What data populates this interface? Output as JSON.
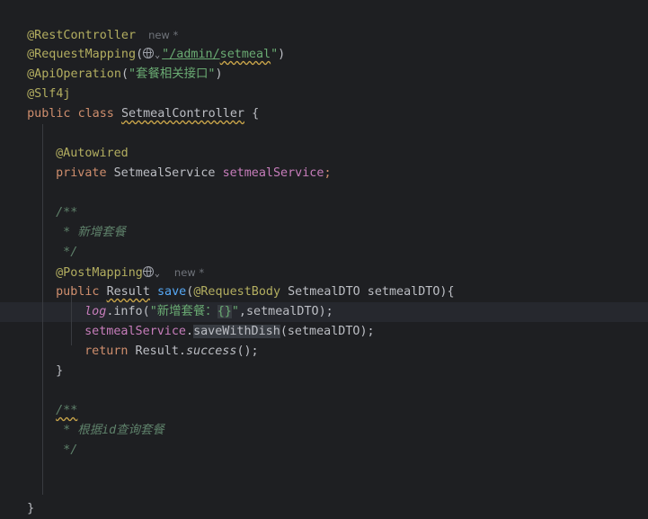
{
  "editor": {
    "inlay_new": "new *",
    "class_annotations": {
      "rest": "@RestController",
      "mapping_name": "@RequestMapping",
      "mapping_open": "(",
      "mapping_path_prefix": "\"/admin/",
      "mapping_path_word": "setmeal",
      "mapping_path_suffix": "\"",
      "mapping_close": ")",
      "api_name": "@ApiOperation",
      "api_open": "(",
      "api_value": "\"套餐相关接口\"",
      "api_close": ")",
      "slf4j": "@Slf4j"
    },
    "class_decl": {
      "public": "public",
      "class": "class",
      "name": "SetmealController",
      "brace": "{"
    },
    "field": {
      "annotation": "@Autowired",
      "modifier": "private",
      "type": "SetmealService",
      "name": "setmealService",
      "semi": ";"
    },
    "doc1": {
      "open": "/**",
      "text": " * 新增套餐",
      "close": " */"
    },
    "method": {
      "annotation": "@PostMapping",
      "modifier": "public",
      "return_type": "Result",
      "name": "save",
      "params_open": "(",
      "param_annotation": "@RequestBody",
      "param_rest": " SetmealDTO setmealDTO){"
    },
    "body": {
      "log_var": "log",
      "log_call": ".info(",
      "log_str_a": "\"新增套餐：",
      "log_str_braces": "{}",
      "log_str_end": "\"",
      "log_args": ",setmealDTO);",
      "svc_field": "setmealService",
      "svc_dot": ".",
      "svc_method": "saveWithDish",
      "svc_args": "(setmealDTO);",
      "return_kw": "return",
      "return_rest_a": " Result.",
      "return_method": "success",
      "return_rest_b": "();",
      "close": "}"
    },
    "doc2": {
      "open": "/**",
      "text": " * 根据id查询套餐",
      "close": " */"
    },
    "class_close": "}"
  }
}
